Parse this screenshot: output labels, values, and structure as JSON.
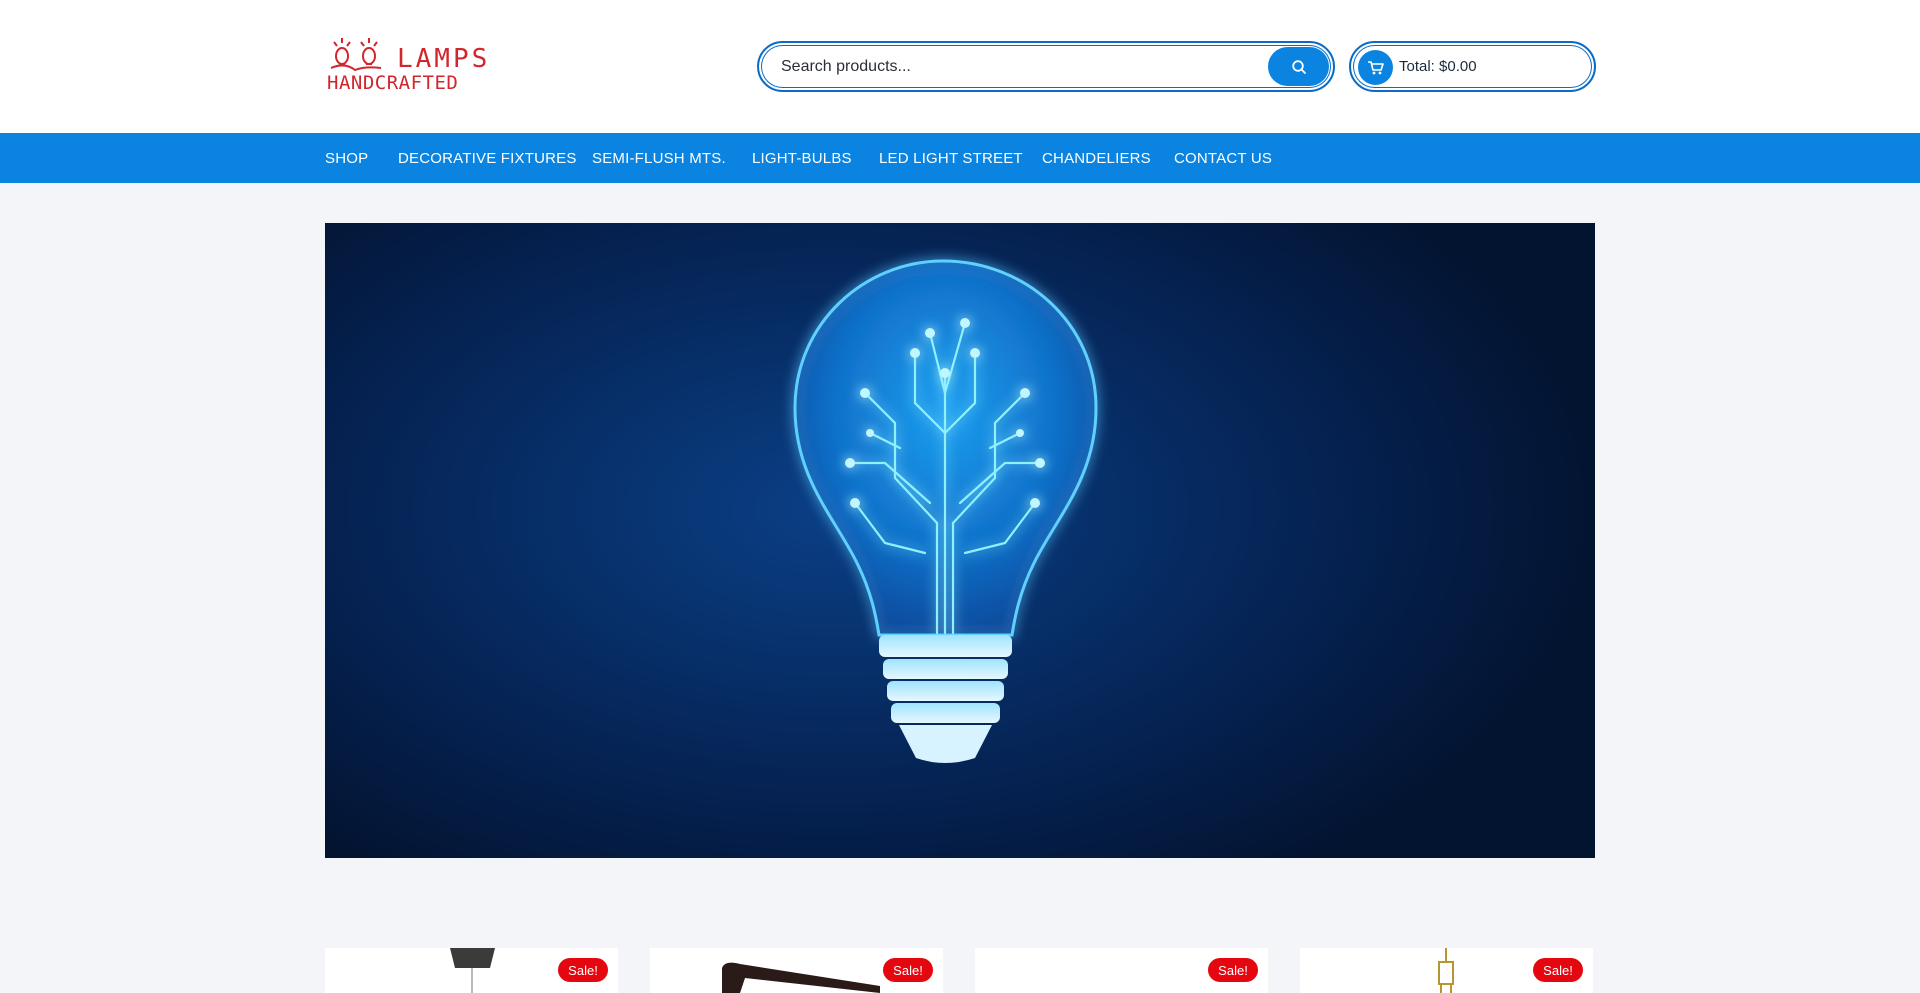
{
  "brand": {
    "line1": "LAMPS",
    "line2": "HANDCRAFTED",
    "color": "#d1262d"
  },
  "search": {
    "placeholder": "Search products..."
  },
  "cart": {
    "total_label": "Total: $0.00"
  },
  "nav": {
    "items": [
      "SHOP",
      "DECORATIVE FIXTURES",
      "SEMI-FLUSH MTS.",
      "LIGHT-BULBS",
      "LED LIGHT STREET",
      "CHANDELIERS",
      "CONTACT US"
    ]
  },
  "products": [
    {
      "badge": "Sale!"
    },
    {
      "badge": "Sale!"
    },
    {
      "badge": "Sale!"
    },
    {
      "badge": "Sale!"
    }
  ],
  "colors": {
    "accent": "#0a84e0",
    "sale": "#e5070f",
    "hero_bg": "#052252"
  },
  "icons": {
    "search": "search-icon",
    "cart": "cart-icon"
  }
}
